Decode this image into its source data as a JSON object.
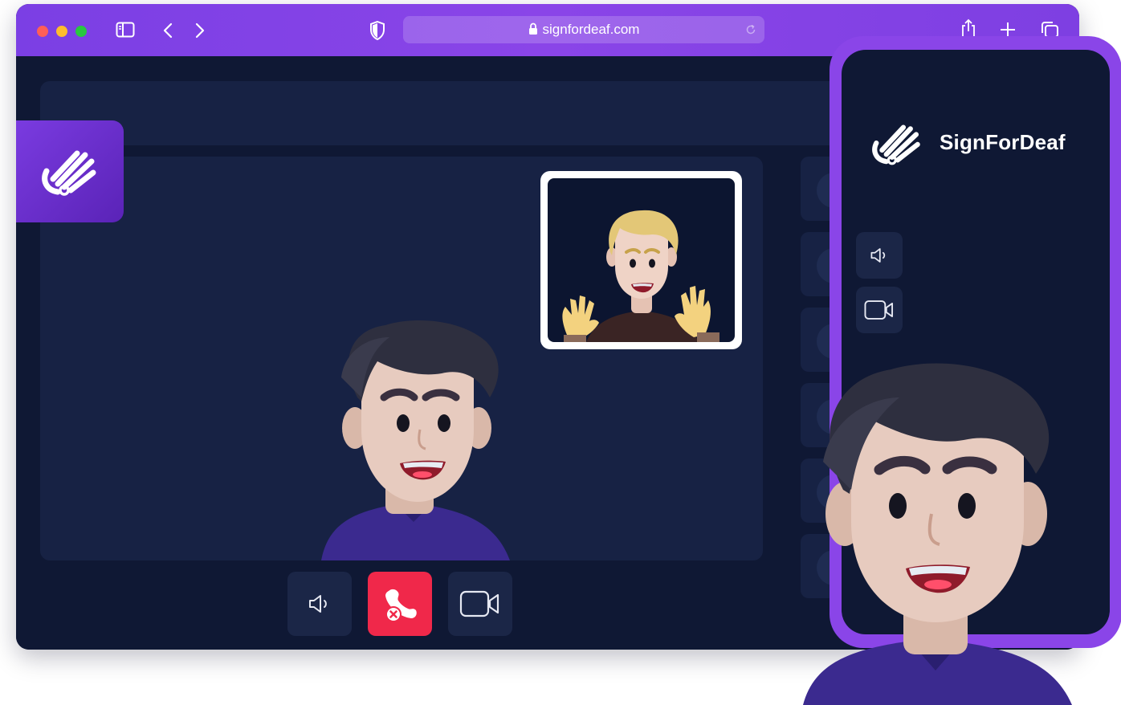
{
  "browser": {
    "url": "signfordeaf.com",
    "traffic_lights": {
      "close": "#ff5f57",
      "minimize": "#febc2e",
      "zoom": "#28c840"
    },
    "icons": [
      "sidebar-icon",
      "back-icon",
      "forward-icon",
      "shield-icon",
      "lock-icon",
      "reload-icon",
      "share-icon",
      "new-tab-icon",
      "tabs-icon"
    ]
  },
  "call": {
    "controls": [
      {
        "name": "speaker",
        "icon": "speaker-icon"
      },
      {
        "name": "end-call",
        "icon": "phone-hangup-icon",
        "color": "#f0284a"
      },
      {
        "name": "camera",
        "icon": "video-camera-icon"
      }
    ]
  },
  "phone": {
    "brand": "SignForDeaf",
    "buttons": [
      "speaker-icon",
      "video-camera-icon"
    ]
  },
  "colors": {
    "accent": "#8a45e8",
    "background": "#0f1834",
    "panel": "#172244",
    "danger": "#f0284a"
  }
}
